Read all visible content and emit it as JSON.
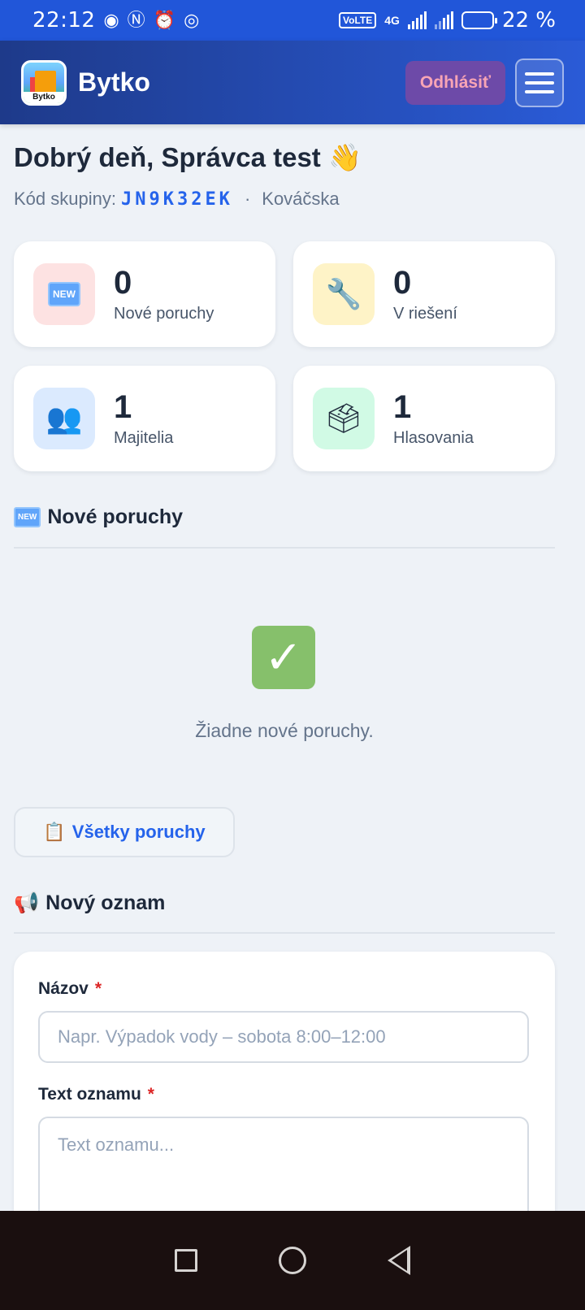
{
  "status_bar": {
    "time": "22:12",
    "icons": [
      "eye-icon",
      "nfc-icon",
      "alarm-icon",
      "chrome-icon"
    ],
    "volte": "VoLTE",
    "network": "4G",
    "battery_percent": "22 %"
  },
  "header": {
    "app_name": "Bytko",
    "logo_text": "Bytko",
    "logout_label": "Odhlásiť"
  },
  "greeting": {
    "title": "Dobrý deň, Správca test 👋",
    "group_label": "Kód skupiny:",
    "group_code": "JN9K32EK",
    "separator": "·",
    "street": "Kováčska"
  },
  "stats": [
    {
      "icon": "new-icon",
      "value": "0",
      "label": "Nové poruchy",
      "color": "#fde2e2"
    },
    {
      "icon": "wrench-icon",
      "value": "0",
      "label": "V riešení",
      "color": "#fef3c7"
    },
    {
      "icon": "people-icon",
      "value": "1",
      "label": "Majitelia",
      "color": "#dbeafe"
    },
    {
      "icon": "ballot-box-icon",
      "value": "1",
      "label": "Hlasovania",
      "color": "#d1fae5"
    }
  ],
  "new_faults": {
    "title": "Nové poruchy",
    "badge": "NEW",
    "empty_text": "Žiadne nové poruchy.",
    "all_button": "Všetky poruchy"
  },
  "announcement": {
    "title": "Nový oznam",
    "name_label": "Názov",
    "name_placeholder": "Napr. Výpadok vody – sobota 8:00–12:00",
    "text_label": "Text oznamu",
    "text_placeholder": "Text oznamu...",
    "required_mark": "*"
  },
  "colors": {
    "accent": "#2563eb",
    "header_start": "#1e3a8a",
    "header_end": "#2a5bd7"
  }
}
